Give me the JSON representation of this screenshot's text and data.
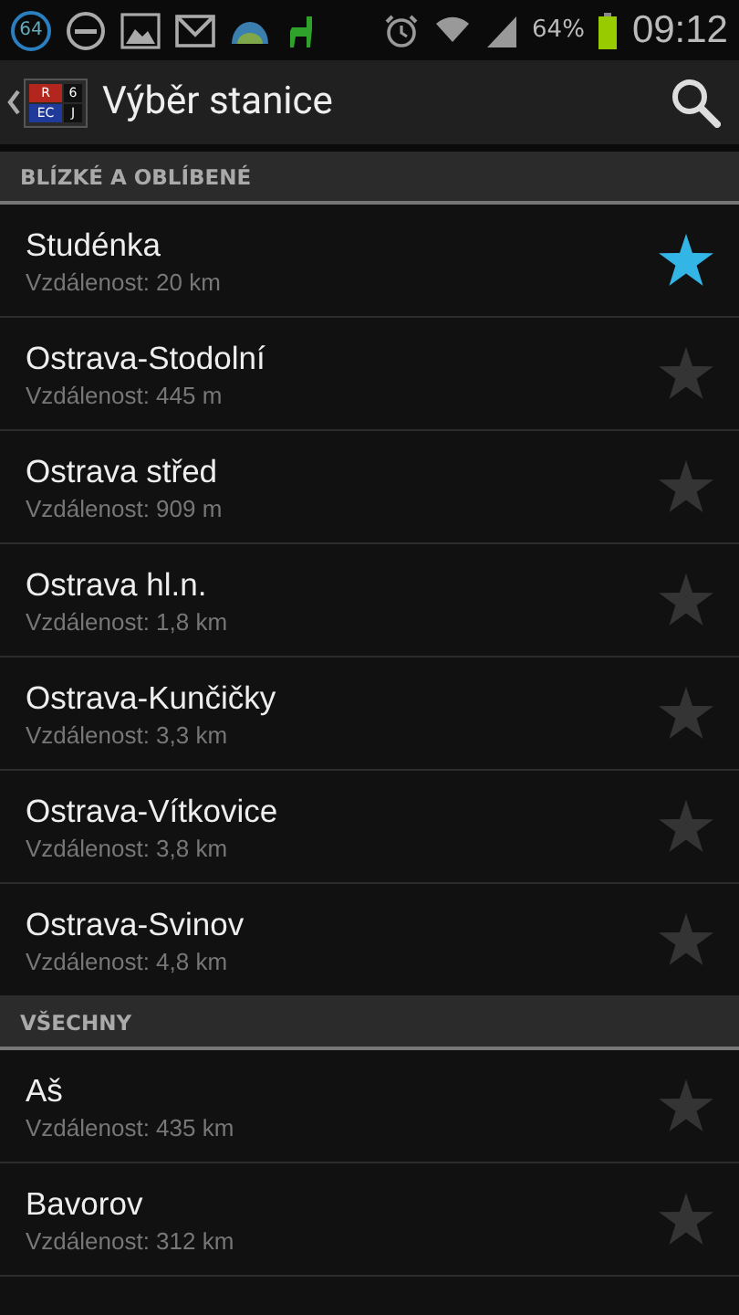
{
  "status_bar": {
    "badge": "64",
    "battery": "64%",
    "time": "09:12"
  },
  "app_bar": {
    "logo_cells": [
      "R",
      "6",
      "EC",
      "J"
    ],
    "title": "Výběr stanice"
  },
  "sections": [
    {
      "title": "BLÍZKÉ A OBLÍBENÉ",
      "stations": [
        {
          "name": "Studénka",
          "distance": "Vzdálenost: 20 km",
          "favorite": true
        },
        {
          "name": "Ostrava-Stodolní",
          "distance": "Vzdálenost: 445 m",
          "favorite": false
        },
        {
          "name": "Ostrava střed",
          "distance": "Vzdálenost: 909 m",
          "favorite": false
        },
        {
          "name": "Ostrava hl.n.",
          "distance": "Vzdálenost: 1,8 km",
          "favorite": false
        },
        {
          "name": "Ostrava-Kunčičky",
          "distance": "Vzdálenost: 3,3 km",
          "favorite": false
        },
        {
          "name": "Ostrava-Vítkovice",
          "distance": "Vzdálenost: 3,8 km",
          "favorite": false
        },
        {
          "name": "Ostrava-Svinov",
          "distance": "Vzdálenost: 4,8 km",
          "favorite": false
        }
      ]
    },
    {
      "title": "VŠECHNY",
      "stations": [
        {
          "name": "Aš",
          "distance": "Vzdálenost: 435 km",
          "favorite": false
        },
        {
          "name": "Bavorov",
          "distance": "Vzdálenost: 312 km",
          "favorite": false
        }
      ]
    }
  ]
}
